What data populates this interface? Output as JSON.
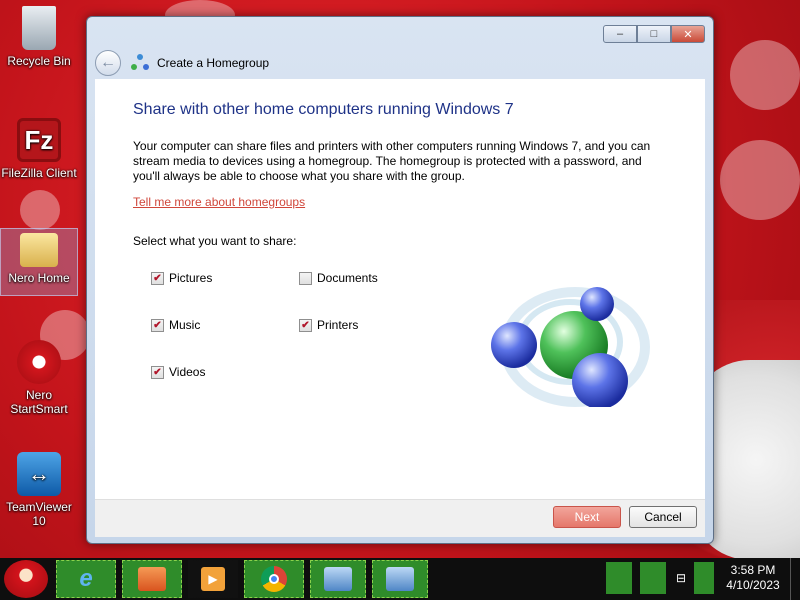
{
  "desktop": {
    "icons": [
      {
        "label": "Recycle Bin",
        "icon": "recycle-bin-icon"
      },
      {
        "label": "FileZilla Client",
        "icon": "filezilla-icon"
      },
      {
        "label": "Nero Home",
        "icon": "nero-home-icon"
      },
      {
        "label": "Nero StartSmart",
        "icon": "nero-startsmart-icon"
      },
      {
        "label": "TeamViewer 10",
        "icon": "teamviewer-icon"
      }
    ]
  },
  "window": {
    "title": "Create a Homegroup",
    "controls": {
      "minimize": "–",
      "maximize": "□",
      "close": "✕"
    }
  },
  "content": {
    "heading": "Share with other home computers running Windows 7",
    "description": "Your computer can share files and printers with other computers running Windows 7, and you can stream media to devices using a homegroup. The homegroup is protected with a password, and you'll always be able to choose what you share with the group.",
    "link": "Tell me more about homegroups",
    "select_label": "Select what you want to share:",
    "options": [
      {
        "label": "Pictures",
        "checked": true
      },
      {
        "label": "Documents",
        "checked": false
      },
      {
        "label": "Music",
        "checked": true
      },
      {
        "label": "Printers",
        "checked": true
      },
      {
        "label": "Videos",
        "checked": true
      }
    ]
  },
  "buttons": {
    "next": "Next",
    "cancel": "Cancel"
  },
  "taskbar": {
    "apps": [
      "internet-explorer-icon",
      "file-manager-icon",
      "media-player-icon",
      "chrome-icon",
      "control-panel-icon",
      "control-panel-icon"
    ],
    "clock": {
      "time": "3:58 PM",
      "date": "4/10/2023"
    }
  },
  "colors": {
    "accent": "#1e3287",
    "link": "#d0463a",
    "next_button": "#e5776a"
  }
}
